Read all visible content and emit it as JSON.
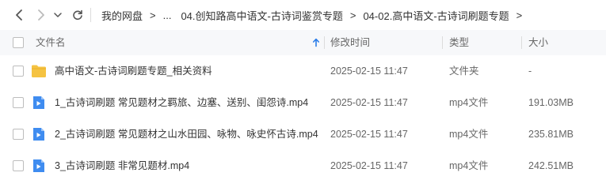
{
  "toolbar": {
    "back_icon": "chevron-left-icon",
    "forward_icon": "chevron-right-icon",
    "dropdown_icon": "chevron-down-icon",
    "refresh_icon": "refresh-icon"
  },
  "breadcrumb": {
    "root": "我的网盘",
    "ellipsis": "...",
    "items": [
      "04.创知路高中语文-古诗词鉴赏专题",
      "04-02.高中语文-古诗词刷题专题"
    ],
    "separator": ">"
  },
  "columns": {
    "name": "文件名",
    "modified": "修改时间",
    "type": "类型",
    "size": "大小"
  },
  "files": [
    {
      "name": "高中语文-古诗词刷题专题_相关资料",
      "modified": "2025-02-15 11:47",
      "type": "文件夹",
      "size": "-",
      "icon": "folder-icon"
    },
    {
      "name": "1_古诗词刷题 常见题材之羁旅、边塞、送别、闺怨诗.mp4",
      "modified": "2025-02-15 11:47",
      "type": "mp4文件",
      "size": "191.03MB",
      "icon": "video-file-icon"
    },
    {
      "name": "2_古诗词刷题 常见题材之山水田园、咏物、咏史怀古诗.mp4",
      "modified": "2025-02-15 11:47",
      "type": "mp4文件",
      "size": "235.81MB",
      "icon": "video-file-icon"
    },
    {
      "name": "3_古诗词刷题 非常见题材.mp4",
      "modified": "2025-02-15 11:47",
      "type": "mp4文件",
      "size": "242.51MB",
      "icon": "video-file-icon"
    }
  ],
  "colors": {
    "accent": "#2b7de9",
    "folder": "#f5c342",
    "header_bg": "#f7f8fa"
  }
}
